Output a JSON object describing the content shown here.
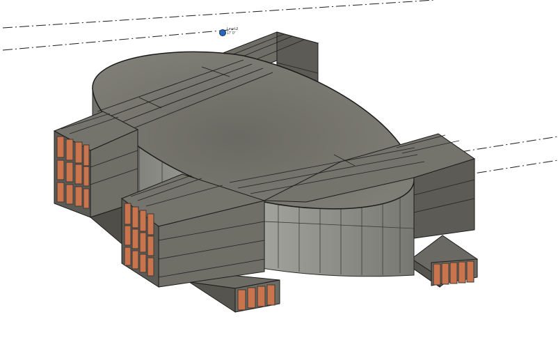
{
  "view": {
    "background": "#ffffff",
    "level_marker": {
      "name": "Level 3",
      "elevation": "17' 0\""
    }
  },
  "colors": {
    "roof": "#6e6d66",
    "roof_light": "#85847c",
    "wall_front": "#6f6e67",
    "wall_side": "#5c5b55",
    "glass": "#9a9b95",
    "window": "#c9744c",
    "window_frame": "#3a3934",
    "level_marker": "#2b67b5"
  },
  "icons": {
    "level_marker": "level-head-icon"
  }
}
